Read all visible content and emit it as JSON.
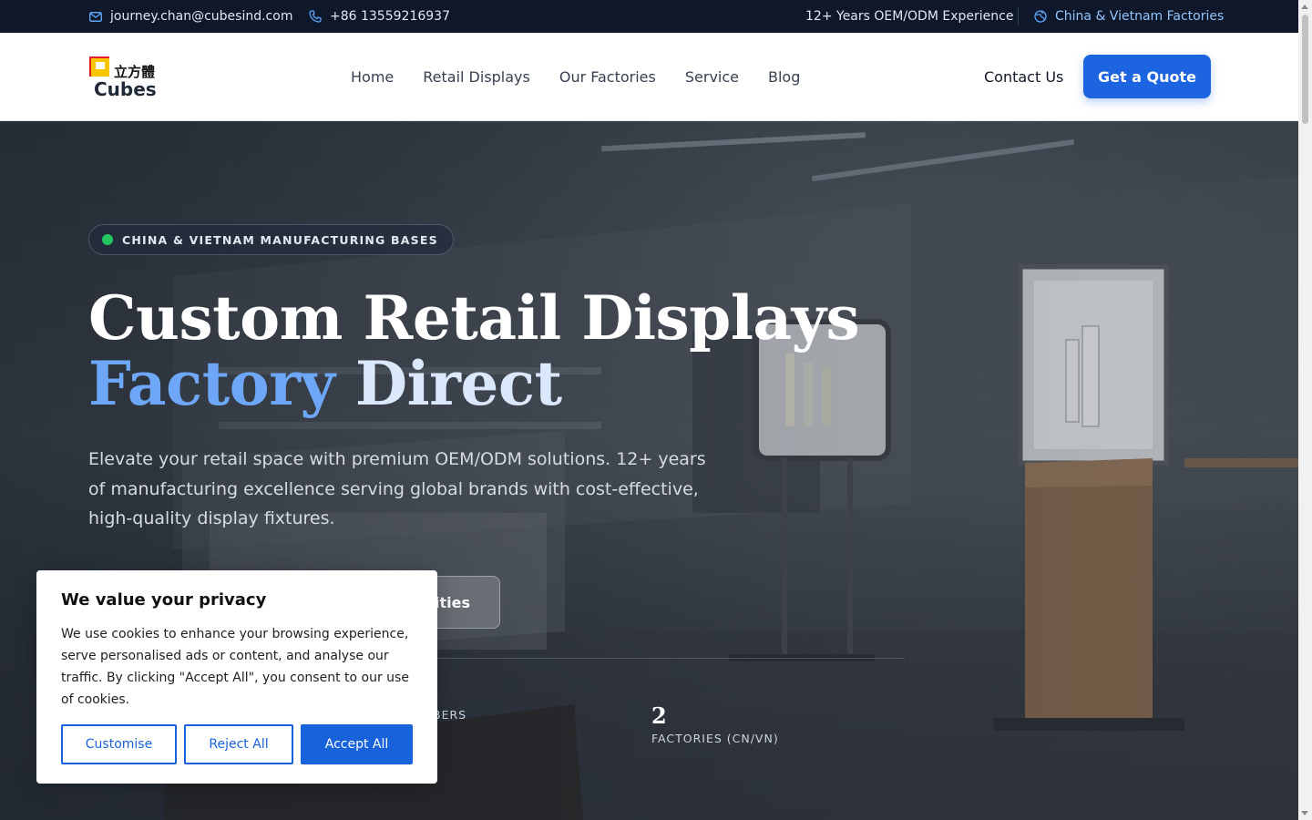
{
  "topbar": {
    "email": "journey.chan@cubesind.com",
    "phone": "+86 13559216937",
    "experience": "12+ Years OEM/ODM Experience",
    "factories": "China & Vietnam Factories"
  },
  "header": {
    "logo_text": "Cubes",
    "logo_cn": "立方體",
    "nav": [
      "Home",
      "Retail Displays",
      "Our Factories",
      "Service",
      "Blog"
    ],
    "contact_label": "Contact Us",
    "quote_label": "Get a Quote"
  },
  "hero": {
    "badge": "CHINA & VIETNAM MANUFACTURING BASES",
    "title_line1": "Custom Retail Displays",
    "title_line2_a": "Factory",
    "title_line2_b": "Direct",
    "lead": "Elevate your retail space with premium OEM/ODM solutions. 12+ years of manufacturing excellence serving global brands with cost-effective, high-quality display fixtures.",
    "secondary_btn_partial": "ilities",
    "stats": [
      {
        "num": "",
        "label": "BERS"
      },
      {
        "num": "2",
        "label": "FACTORIES (CN/VN)"
      }
    ]
  },
  "cookie": {
    "title": "We value your privacy",
    "body": "We use cookies to enhance your browsing experience, serve personalised ads or content, and analyse our traffic. By clicking \"Accept All\", you consent to our use of cookies.",
    "customise": "Customise",
    "reject": "Reject All",
    "accept": "Accept All"
  },
  "colors": {
    "topbar_bg": "#0f172a",
    "accent_blue": "#1d64e0",
    "cookie_blue": "#1863dc",
    "status_green": "#22c55e"
  },
  "icons": {
    "email": "mail-icon",
    "phone": "phone-icon",
    "globe": "globe-icon"
  }
}
